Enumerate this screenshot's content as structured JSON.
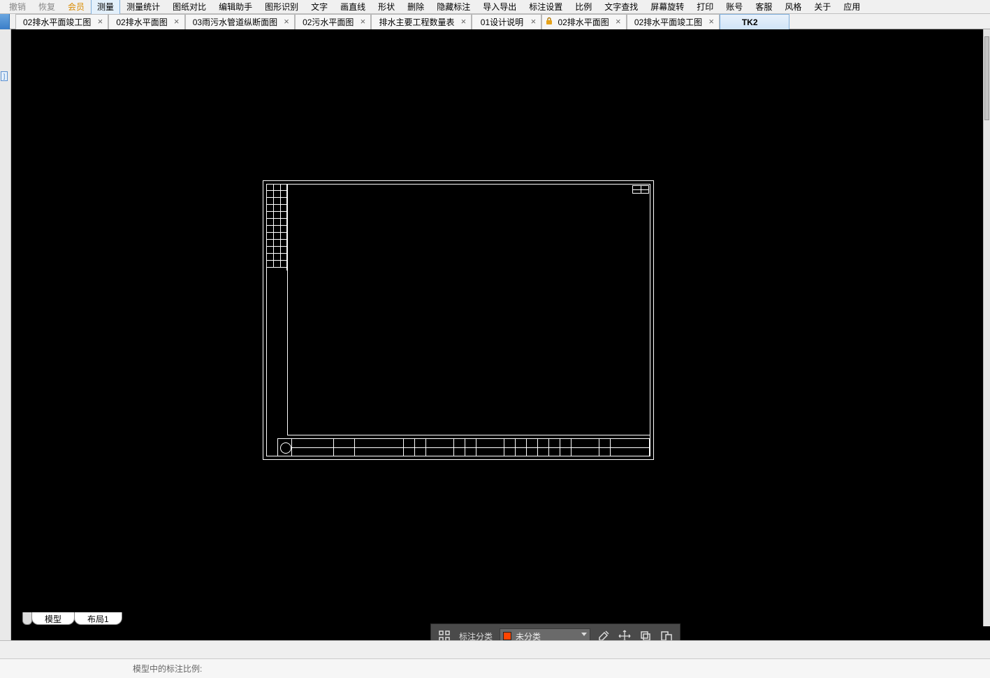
{
  "menubar": {
    "undo": "撤销",
    "redo": "恢复",
    "vip": "会员",
    "measure": "测量",
    "measure_stats": "测量统计",
    "compare": "图纸对比",
    "edit_helper": "编辑助手",
    "shape_recog": "图形识别",
    "text": "文字",
    "draw_line": "画直线",
    "shape": "形状",
    "delete": "删除",
    "hide_anno": "隐藏标注",
    "import_export": "导入导出",
    "anno_settings": "标注设置",
    "scale": "比例",
    "text_search": "文字查找",
    "rotate_screen": "屏幕旋转",
    "print": "打印",
    "account": "账号",
    "support": "客服",
    "style": "风格",
    "about": "关于",
    "apps": "应用"
  },
  "tabs": [
    {
      "label": "02排水平面竣工图",
      "closable": true
    },
    {
      "label": "02排水平面图",
      "closable": true
    },
    {
      "label": "03雨污水管道纵断面图",
      "closable": true
    },
    {
      "label": "02污水平面图",
      "closable": true
    },
    {
      "label": "排水主要工程数量表",
      "closable": true
    },
    {
      "label": "01设计说明",
      "closable": true
    },
    {
      "label": "02排水平面图",
      "closable": true,
      "locked": true
    },
    {
      "label": "02排水平面竣工图",
      "closable": true
    },
    {
      "label": "TK2",
      "closable": false,
      "active": true
    }
  ],
  "float_toolbar": {
    "label": "标注分类",
    "category": "未分类"
  },
  "bottom_tabs": {
    "model": "模型",
    "layout1": "布局1"
  },
  "footer": {
    "hint_prefix": "模型中的标注比例:"
  }
}
